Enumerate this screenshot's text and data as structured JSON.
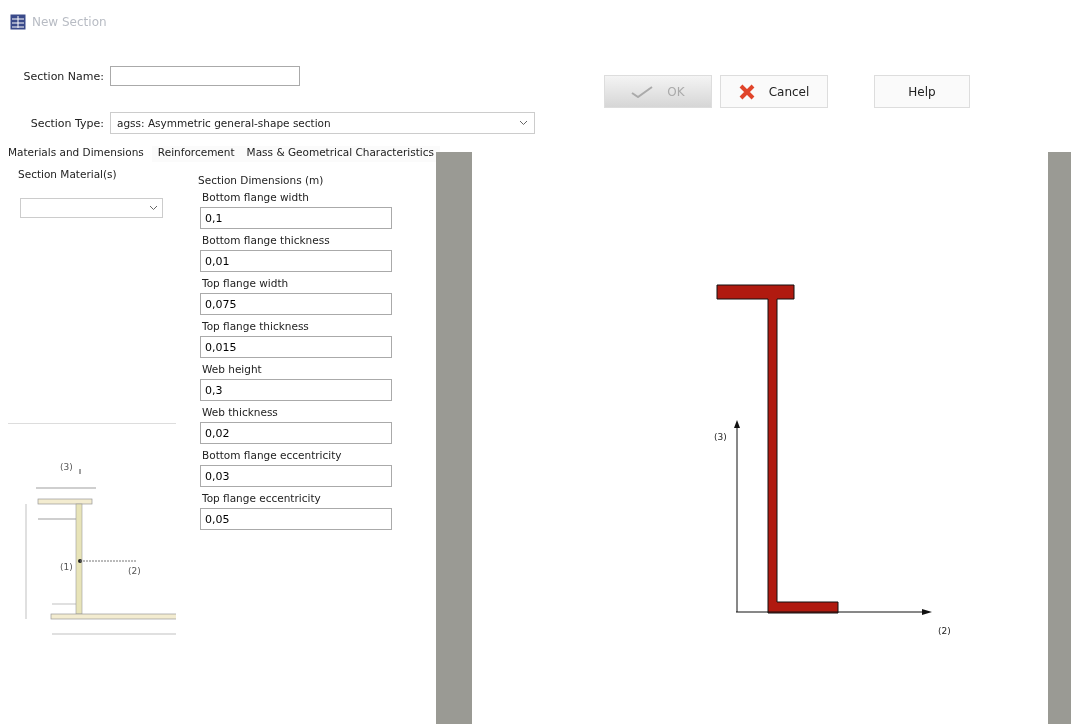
{
  "window": {
    "title": "New Section"
  },
  "form": {
    "name_label": "Section Name:",
    "type_label": "Section Type:",
    "type_value": "agss: Asymmetric general-shape section"
  },
  "buttons": [
    {
      "kind": "ok",
      "label": "OK",
      "disabled": true
    },
    {
      "kind": "cancel",
      "label": "Cancel",
      "disabled": false
    },
    {
      "kind": "help",
      "label": "Help",
      "disabled": false
    }
  ],
  "tabs": [
    {
      "label": "Materials and Dimensions",
      "selected": true
    },
    {
      "label": "Reinforcement",
      "selected": false
    },
    {
      "label": "Mass & Geometrical Characteristics",
      "selected": false
    }
  ],
  "materials": {
    "heading": "Section Material(s)"
  },
  "legend_diagram": {
    "labels": [
      "(3)",
      "(1)",
      "(2)"
    ]
  },
  "dimensions": {
    "heading": "Section Dimensions (m)",
    "fields": [
      {
        "label": "Bottom flange width",
        "value": "0,1"
      },
      {
        "label": "Bottom flange thickness",
        "value": "0,01"
      },
      {
        "label": "Top flange width",
        "value": "0,075"
      },
      {
        "label": "Top flange thickness",
        "value": "0,015"
      },
      {
        "label": "Web height",
        "value": "0,3"
      },
      {
        "label": "Web thickness",
        "value": "0,02"
      },
      {
        "label": "Bottom flange eccentricity",
        "value": "0,03"
      },
      {
        "label": "Top flange eccentricity",
        "value": "0,05"
      }
    ]
  },
  "preview": {
    "axis_3": "(3)",
    "axis_2": "(2)"
  }
}
